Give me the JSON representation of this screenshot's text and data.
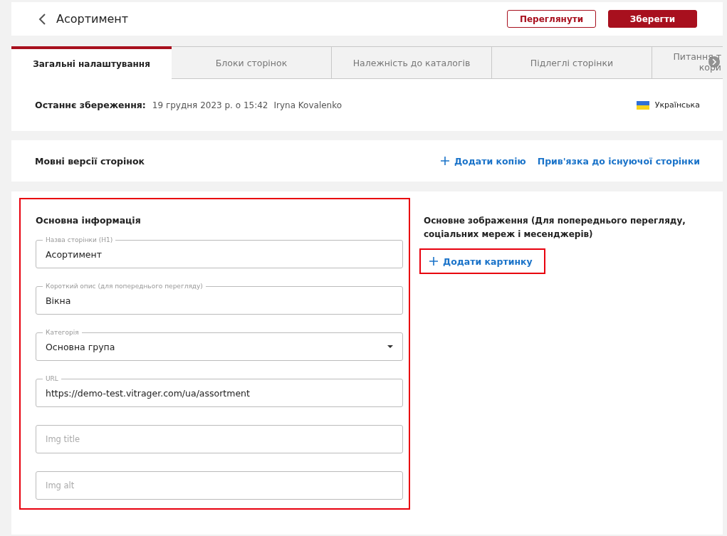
{
  "header": {
    "title": "Асортимент",
    "buttons": [
      {
        "label": "Переглянути",
        "kind": "outline"
      },
      {
        "label": "Зберегти",
        "kind": "primary"
      }
    ]
  },
  "tabs": [
    {
      "label": "Загальні налаштування",
      "selected": true
    },
    {
      "label": "Блоки сторінок",
      "selected": false
    },
    {
      "label": "Належність до каталогів",
      "selected": false
    },
    {
      "label": "Підлеглі сторінки",
      "selected": false
    },
    {
      "label": "Питання т",
      "label_line2": "кори",
      "selected": false
    }
  ],
  "last_save": {
    "label": "Останнє збереження:",
    "date": "19 грудня 2023 р. о 15:42",
    "user": "Iryna Kovalenko",
    "language": "Українська"
  },
  "language_versions": {
    "title": "Мовні версії сторінок",
    "actions": [
      {
        "label": "Додати копію",
        "kind": "add"
      },
      {
        "label": "Прив'язка до існуючої сторінки",
        "kind": "link"
      }
    ]
  },
  "main_info": {
    "title": "Основна інформація",
    "highlighted": true,
    "fields": [
      {
        "kind": "text",
        "label": "Назва сторінки (H1)",
        "value": "Асортимент"
      },
      {
        "kind": "text",
        "label": "Короткий опис (для попереднього перегляду)",
        "value": "Вікна"
      },
      {
        "kind": "select",
        "label": "Категорія",
        "value": "Основна група"
      },
      {
        "kind": "text",
        "label": "URL",
        "value": "https://demo-test.vitrager.com/ua/assortment"
      },
      {
        "kind": "text",
        "placeholder": "Img title"
      },
      {
        "kind": "text",
        "placeholder": "Img alt"
      }
    ]
  },
  "main_image": {
    "title": "Основне зображення (Для попереднього перегляду, соціальних мереж і месенджерів)",
    "add_button": {
      "label": "Додати картинку",
      "highlighted": true
    }
  }
}
